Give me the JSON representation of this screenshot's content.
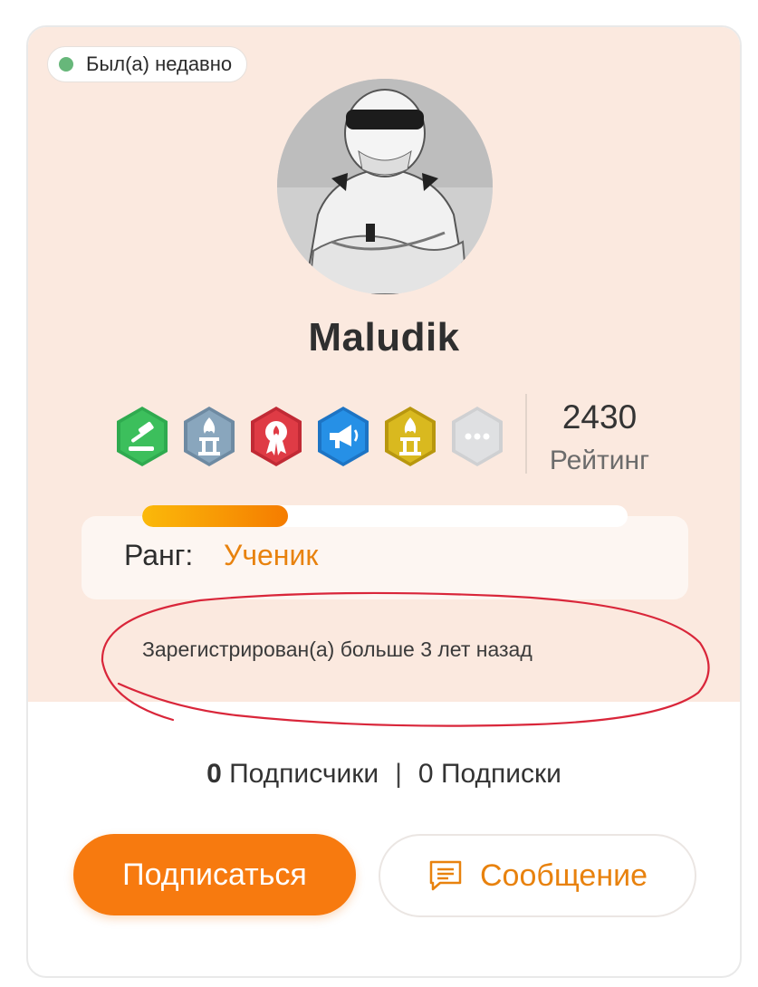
{
  "status": {
    "text": "Был(а) недавно",
    "color": "#67b77a"
  },
  "profile": {
    "username": "Maludik",
    "avatar_icon": "racing-driver-avatar"
  },
  "badges": [
    {
      "icon": "gavel-icon",
      "color": "#2faa4f"
    },
    {
      "icon": "flame-pillar-icon",
      "color": "#7e9bb3"
    },
    {
      "icon": "ribbon-award-icon",
      "color": "#d9343f"
    },
    {
      "icon": "megaphone-icon",
      "color": "#2186dc"
    },
    {
      "icon": "flame-pillar-icon",
      "color": "#d3b21d"
    },
    {
      "icon": "more-icon",
      "color": "#d9dadc"
    }
  ],
  "rating": {
    "value": "2430",
    "label": "Рейтинг"
  },
  "rank": {
    "label": "Ранг:",
    "value": "Ученик",
    "progress": 0.3
  },
  "registration": {
    "text": "Зарегистрирован(а) больше 3 лет назад"
  },
  "follow": {
    "followers_count": "0",
    "followers_label": "Подписчики",
    "separator": "|",
    "following_count": "0",
    "following_label": "Подписки"
  },
  "actions": {
    "subscribe_label": "Подписаться",
    "message_label": "Сообщение"
  },
  "colors": {
    "accent": "#f77a0f",
    "card_bg": "#fbe9df",
    "rank_text": "#e8820e"
  }
}
